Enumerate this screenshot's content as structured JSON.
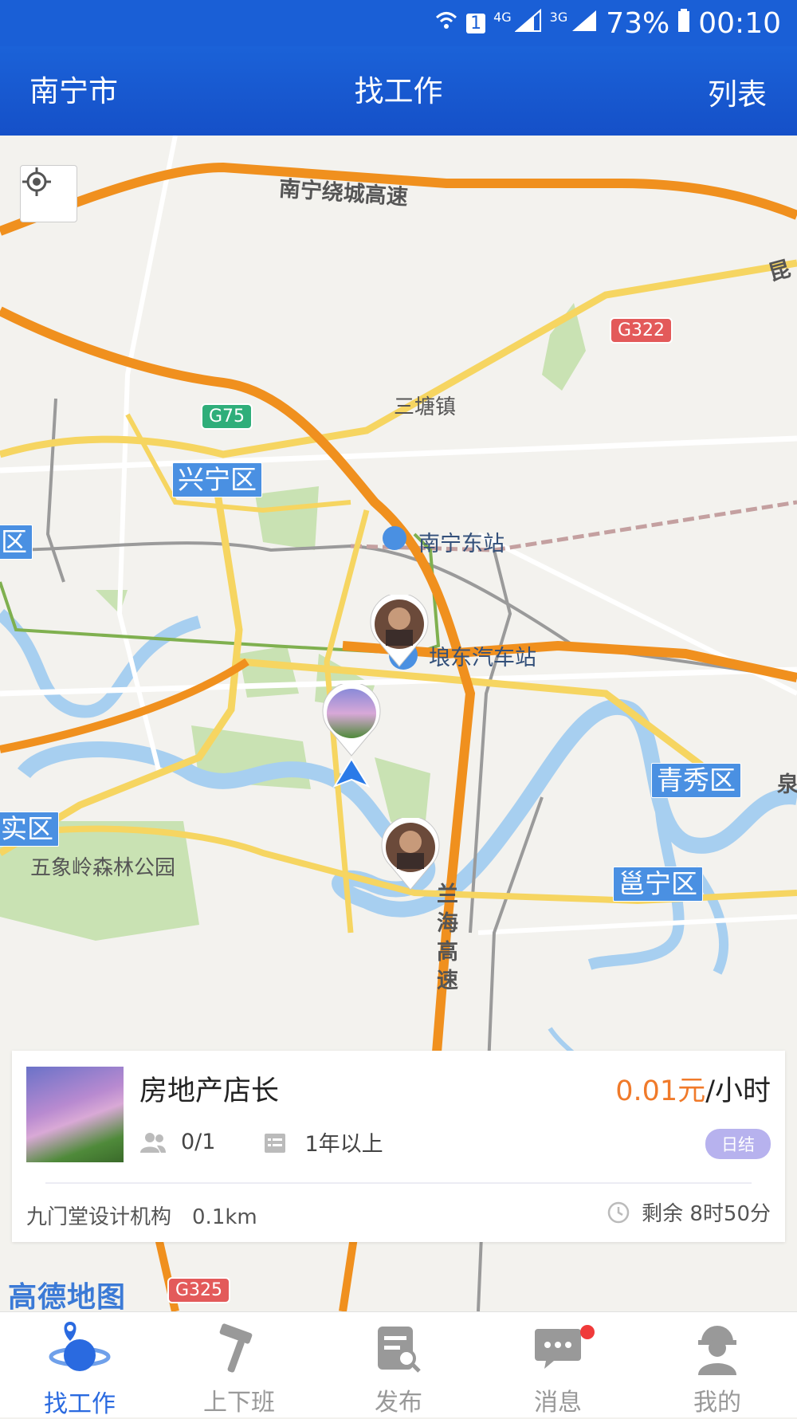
{
  "status_bar": {
    "network_4g": "4G",
    "network_3g": "3G",
    "sim": "1",
    "battery": "73%",
    "time": "00:10"
  },
  "header": {
    "city": "南宁市",
    "title": "找工作",
    "list_button": "列表"
  },
  "map": {
    "road_labels": {
      "ring": "南宁绕城高速",
      "lanhai": "兰海高速",
      "kun": "昆",
      "quan": "泉"
    },
    "shields": {
      "g322": "G322",
      "g75": "G75",
      "g325": "G325"
    },
    "towns": {
      "santang": "三塘镇",
      "park": "五象岭森林公园"
    },
    "stations": {
      "east_station": "南宁东站",
      "bus_station": "埌东汽车站"
    },
    "districts": {
      "xingning": "兴宁区",
      "qingxiu": "青秀区",
      "yongning": "邕宁区",
      "left1": "区",
      "left2": "实区"
    },
    "logo": "高德地图"
  },
  "job_card": {
    "title": "房地产店长",
    "price_amount": "0.01元",
    "price_unit": "/小时",
    "people": "0/1",
    "experience": "1年以上",
    "tag": "日结",
    "company": "九门堂设计机构",
    "distance": "0.1km",
    "remaining": "剩余 8时50分"
  },
  "tabs": [
    {
      "label": "找工作",
      "icon": "globe-pin-icon",
      "active": true
    },
    {
      "label": "上下班",
      "icon": "hammer-icon",
      "active": false
    },
    {
      "label": "发布",
      "icon": "edit-doc-icon",
      "active": false
    },
    {
      "label": "消息",
      "icon": "chat-bubble-icon",
      "active": false,
      "badge": true
    },
    {
      "label": "我的",
      "icon": "worker-helmet-icon",
      "active": false
    }
  ],
  "colors": {
    "primary": "#1a5fd6",
    "price": "#f07a2a",
    "tag": "#b7b2ee",
    "tab_active": "#2a6ae0",
    "badge": "#f03a3a"
  }
}
